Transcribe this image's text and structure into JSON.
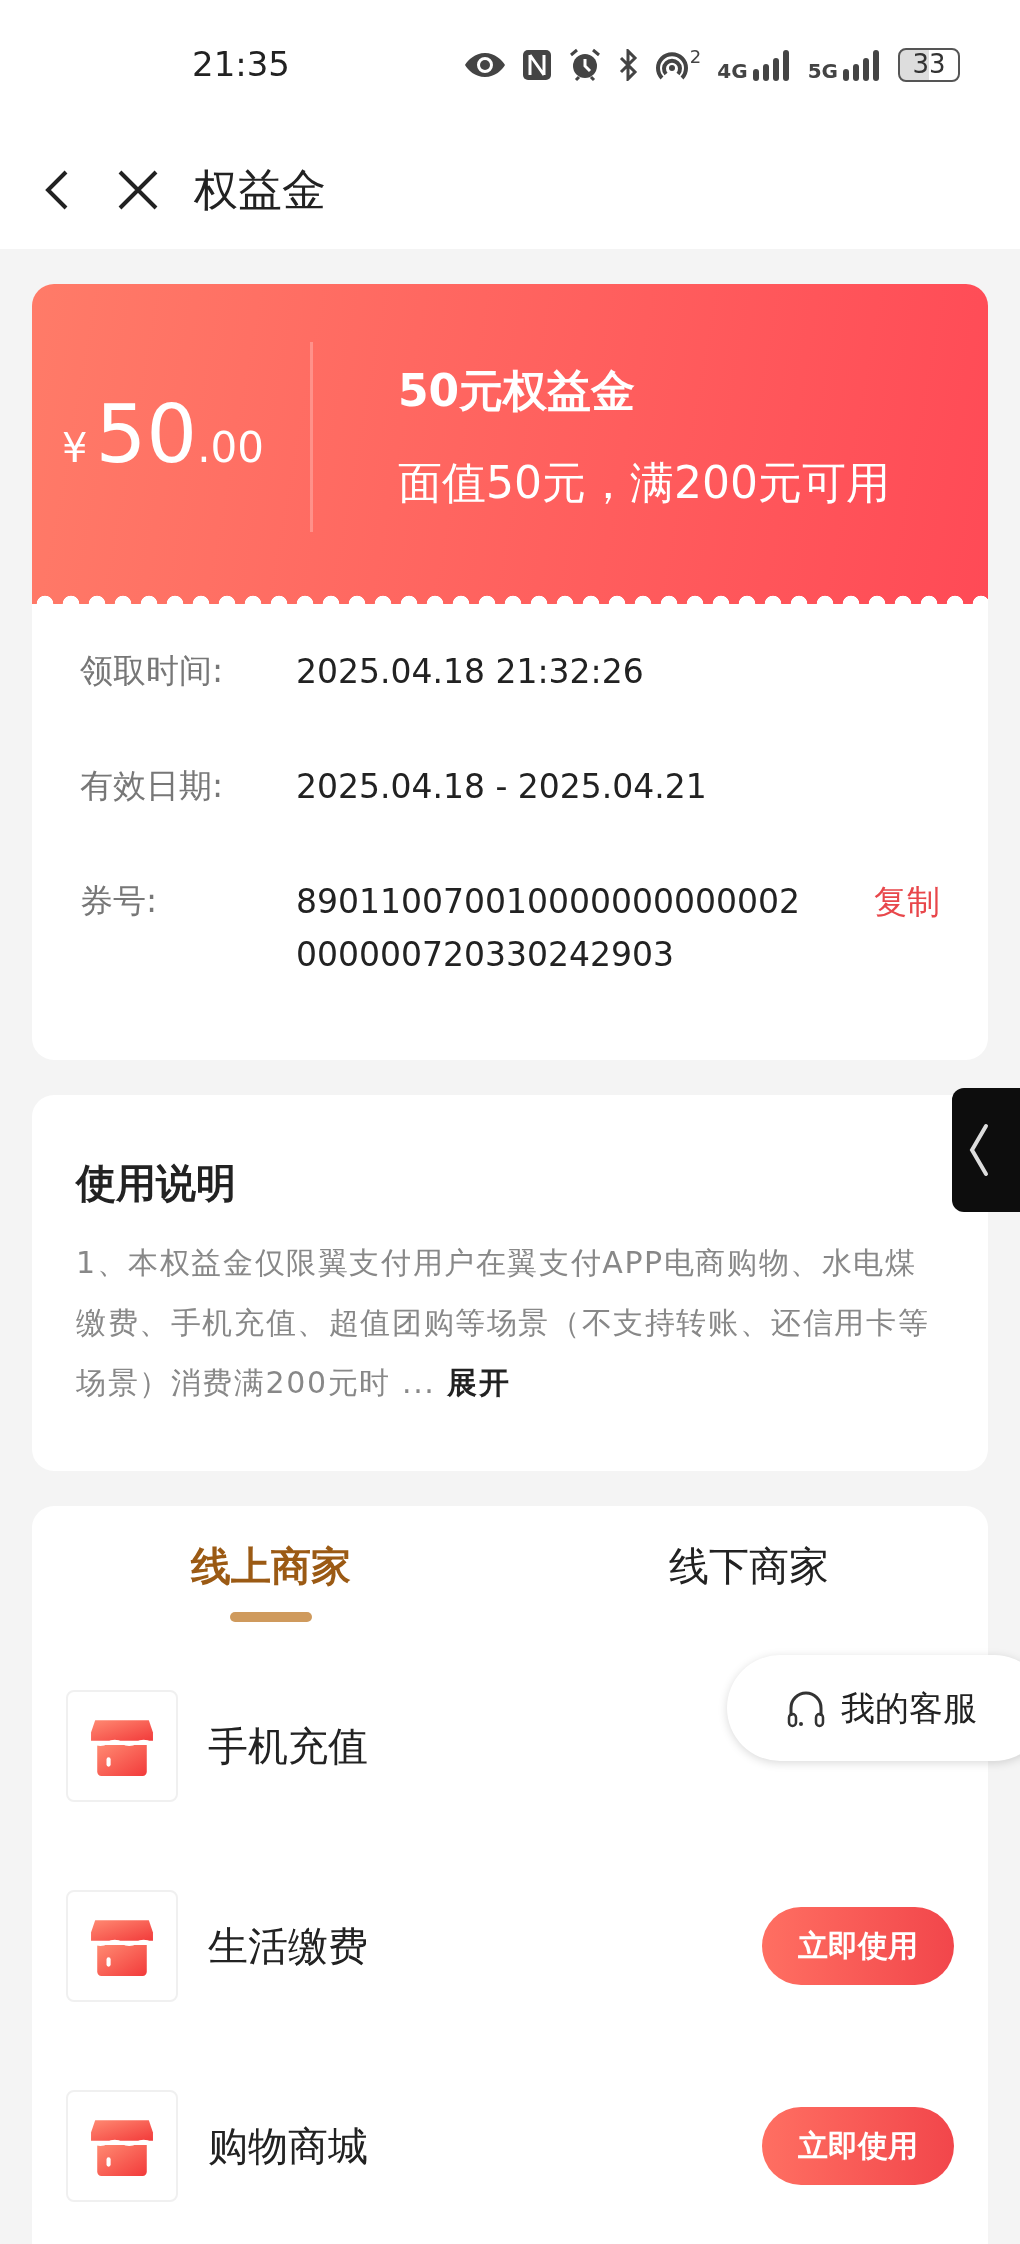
{
  "status_bar": {
    "time": "21:35",
    "hotspot_count": "2",
    "network_1": "4G",
    "network_2": "5G",
    "battery": "33"
  },
  "nav": {
    "title": "权益金"
  },
  "coupon": {
    "currency": "¥",
    "amount_int": "50",
    "amount_dec": ".00",
    "title": "50元权益金",
    "subtitle": "面值50元，满200元可用",
    "details": [
      {
        "label": "领取时间:",
        "value": "2025.04.18 21:32:26"
      },
      {
        "label": "有效日期:",
        "value": "2025.04.18 - 2025.04.21"
      },
      {
        "label": "券号:",
        "value": "890110070010000000000002000000720330242903",
        "action": "复制"
      }
    ]
  },
  "usage": {
    "title": "使用说明",
    "text": "1、本权益金仅限翼支付用户在翼支付APP电商购物、水电煤缴费、手机充值、超值团购等场景（不支持转账、还信用卡等场景）消费满200元时 ...",
    "more": "展开"
  },
  "tabs": [
    {
      "label": "线上商家",
      "selected": true
    },
    {
      "label": "线下商家",
      "selected": false
    }
  ],
  "merchants": [
    {
      "name": "手机充值"
    },
    {
      "name": "生活缴费",
      "button": "立即使用"
    },
    {
      "name": "购物商城",
      "button": "立即使用"
    }
  ],
  "service_button": "我的客服"
}
